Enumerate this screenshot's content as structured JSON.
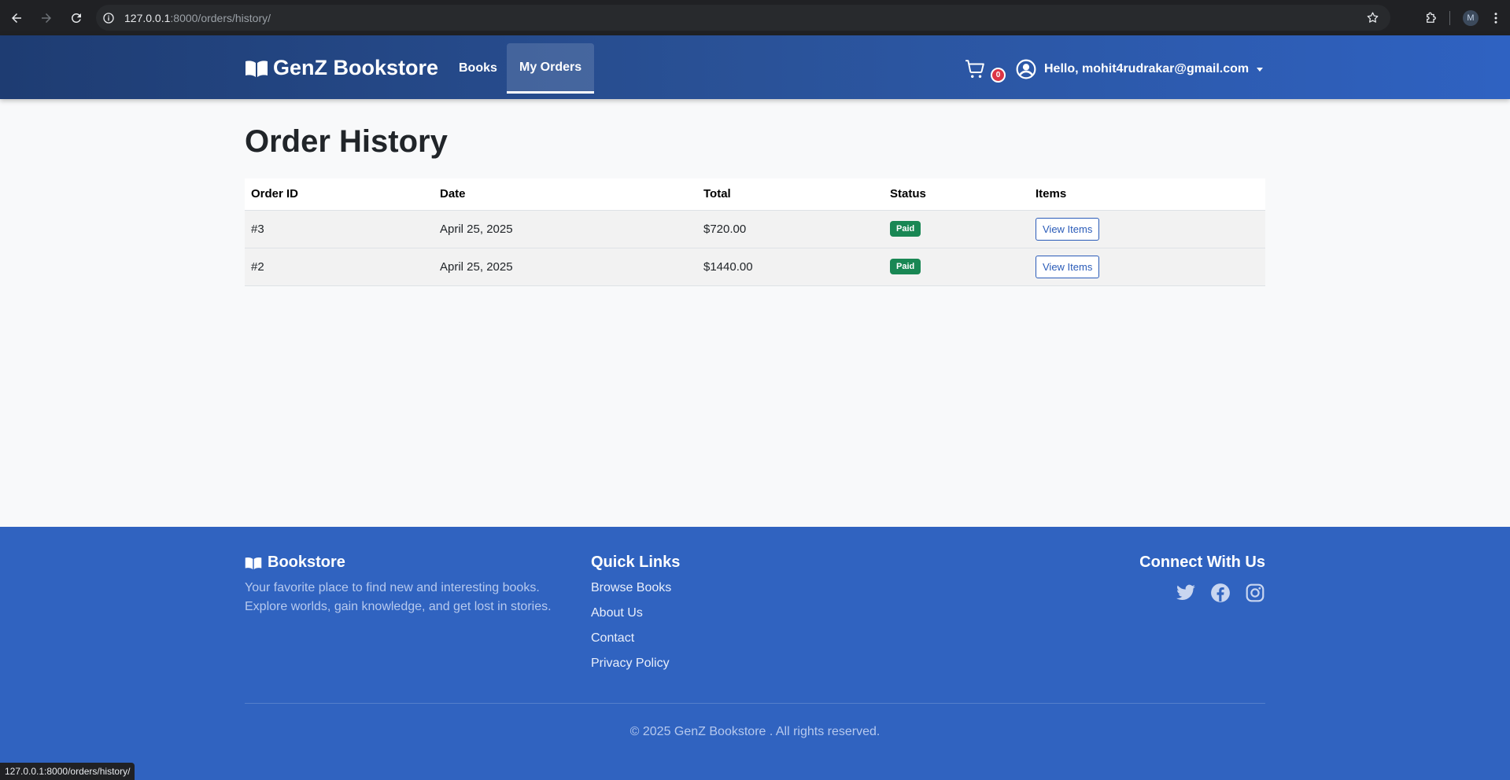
{
  "browser": {
    "url_host": "127.0.0.1",
    "url_rest": ":8000/orders/history/",
    "profile_initial": "M",
    "status_url": "127.0.0.1:8000/orders/history/"
  },
  "navbar": {
    "brand": "GenZ Bookstore",
    "links": [
      {
        "label": "Books",
        "active": false
      },
      {
        "label": "My Orders",
        "active": true
      }
    ],
    "cart_count": "0",
    "user_greeting": "Hello, mohit4rudrakar@gmail.com"
  },
  "main": {
    "title": "Order History",
    "table": {
      "headers": [
        "Order ID",
        "Date",
        "Total",
        "Status",
        "Items"
      ],
      "rows": [
        {
          "id": "#3",
          "date": "April 25, 2025",
          "total": "$720.00",
          "status": "Paid",
          "action": "View Items"
        },
        {
          "id": "#2",
          "date": "April 25, 2025",
          "total": "$1440.00",
          "status": "Paid",
          "action": "View Items"
        }
      ]
    }
  },
  "footer": {
    "brand": "Bookstore",
    "description": "Your favorite place to find new and interesting books. Explore worlds, gain knowledge, and get lost in stories.",
    "quick_links_title": "Quick Links",
    "quick_links": [
      "Browse Books",
      "About Us",
      "Contact",
      "Privacy Policy"
    ],
    "connect_title": "Connect With Us",
    "social": [
      "twitter-icon",
      "facebook-icon",
      "instagram-icon"
    ],
    "copyright": "© 2025 GenZ Bookstore . All rights reserved."
  },
  "colors": {
    "navbar_start": "#1e3c72",
    "navbar_end": "#2f62c2",
    "footer_bg": "#3063c0",
    "paid_badge": "#198754",
    "cart_badge": "#dc3545",
    "button_outline": "#2a5bb8"
  }
}
